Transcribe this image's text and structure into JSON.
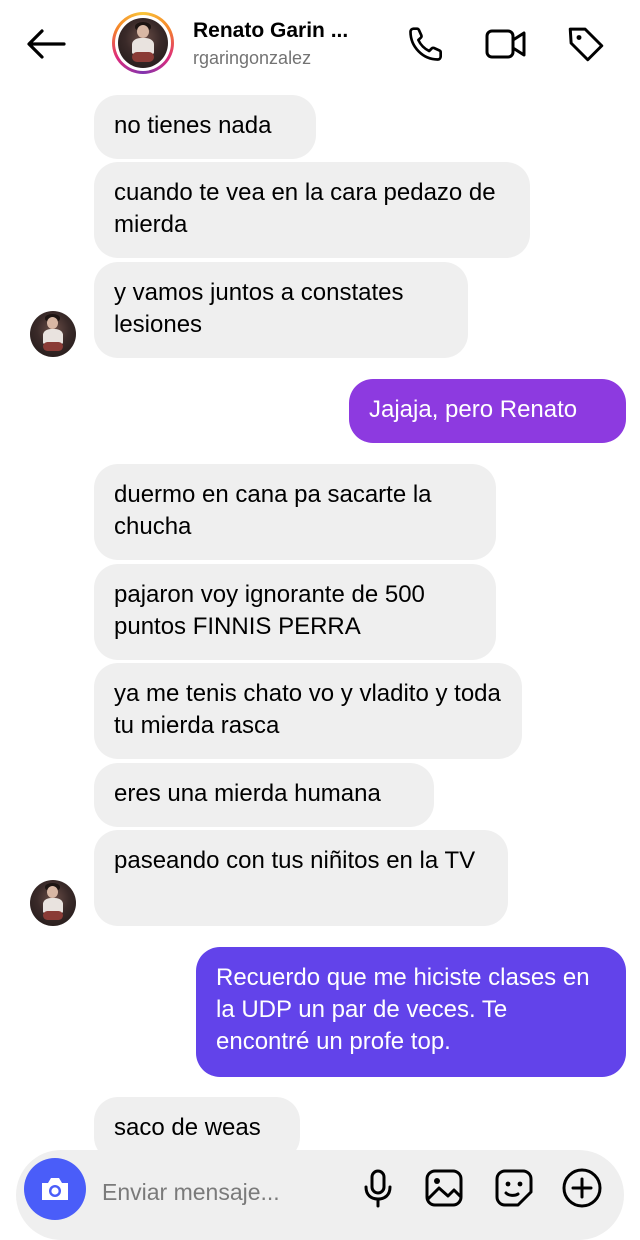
{
  "header": {
    "contact_name": "Renato Garin ...",
    "username": "rgaringonzalez",
    "icons": [
      "back-arrow-icon",
      "phone-icon",
      "video-camera-icon",
      "tag-icon"
    ]
  },
  "messages": [
    {
      "from": "them",
      "text": "no tienes nada"
    },
    {
      "from": "them",
      "text": "cuando te vea en la cara pedazo de mierda"
    },
    {
      "from": "them",
      "text": "y vamos juntos a constates lesiones"
    },
    {
      "from": "me",
      "text": "Jajaja, pero Renato"
    },
    {
      "from": "them",
      "text": "duermo en cana pa sacarte la chucha"
    },
    {
      "from": "them",
      "text": "pajaron voy ignorante de 500 puntos FINNIS PERRA"
    },
    {
      "from": "them",
      "text": "ya me tenis chato vo y vladito y toda tu mierda rasca"
    },
    {
      "from": "them",
      "text": "eres una mierda humana"
    },
    {
      "from": "them",
      "text": "paseando con tus niñitos en la TV"
    },
    {
      "from": "me",
      "text": "Recuerdo que me hiciste clases en la UDP un par de veces. Te encontré un profe top."
    },
    {
      "from": "them",
      "text": "saco de weas"
    }
  ],
  "composer": {
    "placeholder": "Enviar mensaje...",
    "icons": [
      "camera-icon",
      "microphone-icon",
      "image-icon",
      "sticker-icon",
      "plus-icon"
    ]
  },
  "colors": {
    "sent_bubble_top": "#8d3ae0",
    "sent_bubble_bottom": "#6243ea",
    "received_bubble": "#efefef",
    "camera_button": "#4a5df9"
  }
}
